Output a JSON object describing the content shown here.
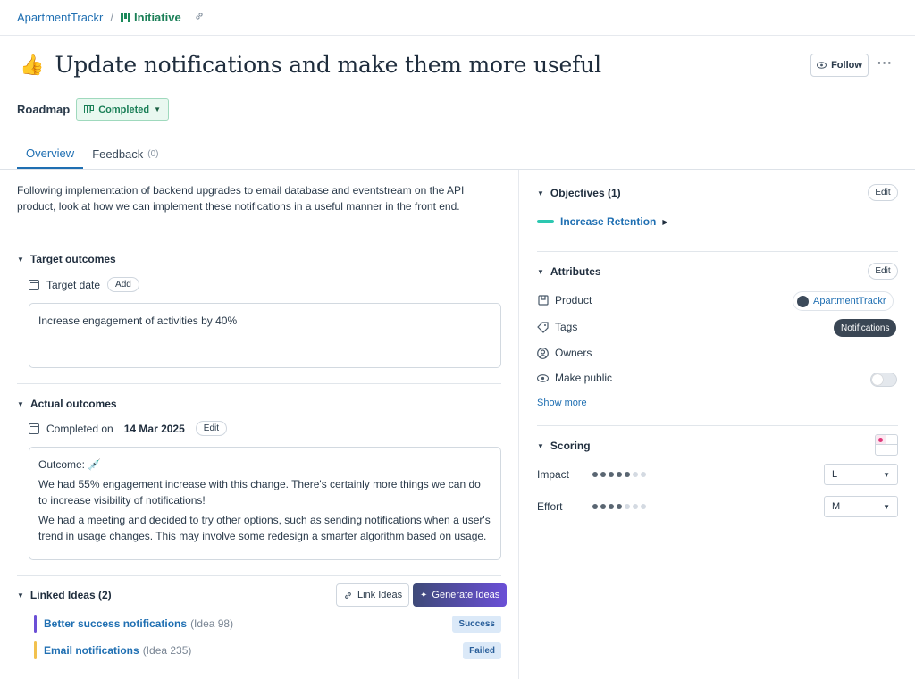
{
  "breadcrumb": {
    "workspace": "ApartmentTrackr",
    "separator": "/",
    "type_label": "Initiative"
  },
  "header": {
    "emoji": "👍",
    "title": "Update notifications and make them more useful",
    "follow_label": "Follow",
    "more_label": "···"
  },
  "roadmap": {
    "label": "Roadmap",
    "status": "Completed",
    "status_color": "#1b7f57"
  },
  "tabs": [
    {
      "label": "Overview",
      "active": true
    },
    {
      "label": "Feedback",
      "count": "(0)",
      "active": false
    }
  ],
  "description": "Following implementation of backend upgrades to email database and eventstream on the API product, look at how we can implement these notifications in a useful manner in the front end.",
  "target_outcomes": {
    "heading": "Target outcomes",
    "target_date_label": "Target date",
    "add_label": "Add",
    "text": "Increase engagement of activities by 40%"
  },
  "actual_outcomes": {
    "heading": "Actual outcomes",
    "completed_label": "Completed on",
    "completed_date": "14 Mar 2025",
    "edit_label": "Edit",
    "outcome_label": "Outcome:",
    "outcome_emoji": "💉",
    "paragraph1": "We had 55% engagement increase with this change. There's certainly more things we can do to increase visibility of notifications!",
    "paragraph2": "We had a meeting and decided to try other options, such as sending notifications when a user's trend in usage changes. This may involve some redesign a smarter algorithm based on usage."
  },
  "linked_ideas": {
    "heading": "Linked Ideas (2)",
    "link_label": "Link Ideas",
    "generate_label": "Generate Ideas",
    "items": [
      {
        "title": "Better success notifications",
        "num": "(Idea 98)",
        "badge": "Success",
        "bar_color": "#6b4fd6"
      },
      {
        "title": "Email notifications",
        "num": "(Idea 235)",
        "badge": "Failed",
        "bar_color": "#f2c14e"
      }
    ]
  },
  "objectives": {
    "heading": "Objectives (1)",
    "edit_label": "Edit",
    "item": "Increase Retention",
    "item_color": "#2cc7b0"
  },
  "attributes": {
    "heading": "Attributes",
    "edit_label": "Edit",
    "product_label": "Product",
    "product_value": "ApartmentTrackr",
    "tags_label": "Tags",
    "tag_value": "Notifications",
    "owners_label": "Owners",
    "public_label": "Make public",
    "public_on": false,
    "show_more": "Show more"
  },
  "scoring": {
    "heading": "Scoring",
    "impact_label": "Impact",
    "impact_level": 5,
    "impact_value": "L",
    "effort_label": "Effort",
    "effort_level": 4,
    "effort_value": "M",
    "max_level": 7
  }
}
